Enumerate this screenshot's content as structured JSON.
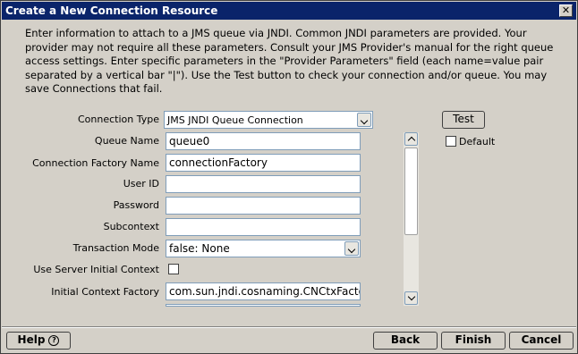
{
  "window": {
    "title": "Create a New Connection Resource",
    "close_glyph": "✕"
  },
  "intro_text": "Enter information to attach to a JMS queue via JNDI. Common JNDI parameters are provided. Your provider may not require all these parameters. Consult your JMS Provider's manual for the right queue access settings. Enter specific parameters in the \"Provider Parameters\" field (each name=value pair separated by a vertical bar \"|\"). Use the Test button to check your connection and/or queue. You may save Connections that fail.",
  "form": {
    "connection_type": {
      "label": "Connection Type",
      "value": "JMS JNDI Queue Connection"
    },
    "queue_name": {
      "label": "Queue Name",
      "value": "queue0"
    },
    "connection_factory_name": {
      "label": "Connection Factory Name",
      "value": "connectionFactory"
    },
    "user_id": {
      "label": "User ID",
      "value": ""
    },
    "password": {
      "label": "Password",
      "value": ""
    },
    "subcontext": {
      "label": "Subcontext",
      "value": ""
    },
    "transaction_mode": {
      "label": "Transaction Mode",
      "value": "false: None"
    },
    "use_server_initial_context": {
      "label": "Use Server Initial Context",
      "checked": false
    },
    "initial_context_factory": {
      "label": "Initial Context Factory",
      "value": "com.sun.jndi.cosnaming.CNCtxFactory"
    }
  },
  "side": {
    "test_label": "Test",
    "default_label": "Default",
    "default_checked": false
  },
  "footer": {
    "help_label": "Help",
    "help_icon_glyph": "?",
    "back_label": "Back",
    "finish_label": "Finish",
    "cancel_label": "Cancel"
  },
  "icons": {
    "close": "close-icon",
    "help": "help-icon",
    "dropdown": "chevron-down-icon",
    "scroll_up": "chevron-up-icon",
    "scroll_down": "chevron-down-icon"
  }
}
